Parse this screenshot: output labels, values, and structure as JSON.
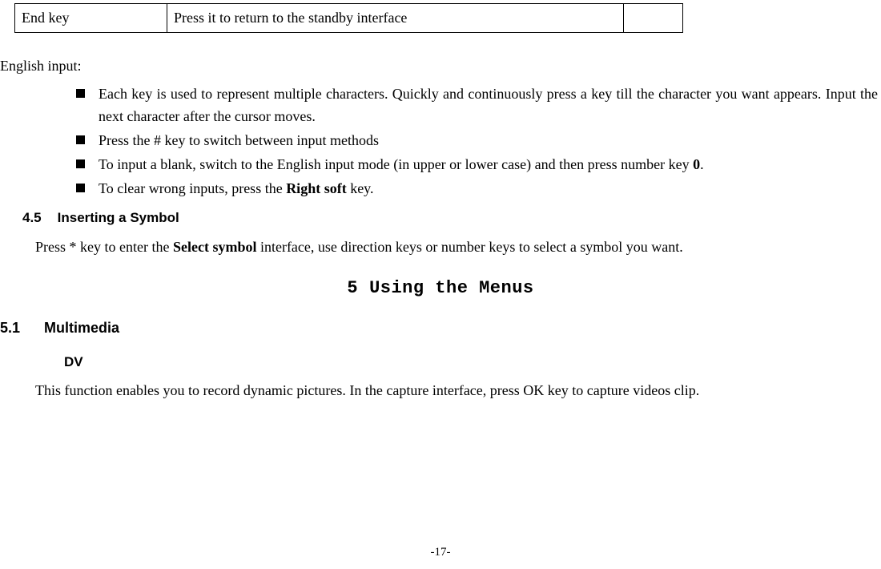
{
  "table": {
    "col1": "End key",
    "col2": "Press it to return to the standby interface",
    "col3": ""
  },
  "englishInputLabel": "English input:",
  "bullets": {
    "b1": "Each key is used to represent multiple characters. Quickly and continuously press a key till the character you want appears. Input the next character after the cursor moves.",
    "b2_pre": "Press the ",
    "b2_hash": "#",
    "b2_post": " key to switch between input methods",
    "b3_pre": "To input a blank, switch to the English input mode (in upper or lower case) and then press number key ",
    "b3_bold": "0",
    "b3_post": ".",
    "b4_pre": "To clear wrong inputs, press the ",
    "b4_bold": "Right soft",
    "b4_post": " key."
  },
  "sec45": {
    "num": "4.5",
    "title": "Inserting a Symbol"
  },
  "sec45body": {
    "pre": "Press * key to enter the ",
    "bold": "Select symbol",
    "post": " interface, use direction keys or number keys to select a symbol you want."
  },
  "chapter": {
    "num": "5",
    "title": "Using the Menus"
  },
  "sec51": {
    "num": "5.1",
    "title": "Multimedia"
  },
  "dvLabel": "DV",
  "dvBody": "This function enables you to record dynamic pictures. In the capture interface, press OK key to capture videos clip.",
  "pageNum": "-17-"
}
